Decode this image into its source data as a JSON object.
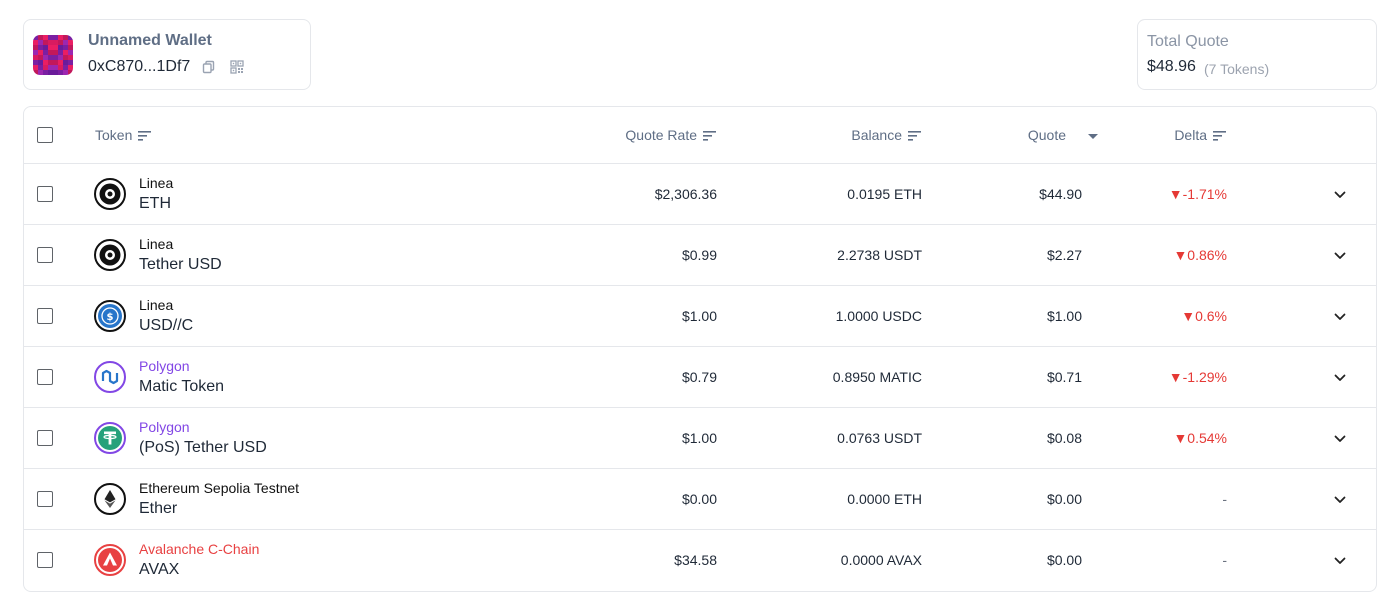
{
  "wallet": {
    "name": "Unnamed Wallet",
    "address": "0xC870...1Df7"
  },
  "total": {
    "label": "Total Quote",
    "value": "$48.96",
    "count": "(7 Tokens)"
  },
  "table": {
    "headers": {
      "token": "Token",
      "quote_rate": "Quote Rate",
      "balance": "Balance",
      "quote": "Quote",
      "delta": "Delta"
    },
    "rows": [
      {
        "chain": "Linea",
        "chain_color": "#111111",
        "token": "ETH",
        "rate": "$2,306.36",
        "balance": "0.0195 ETH",
        "quote": "$44.90",
        "delta": "▼-1.71%",
        "icon": "linea-icon"
      },
      {
        "chain": "Linea",
        "chain_color": "#111111",
        "token": "Tether USD",
        "rate": "$0.99",
        "balance": "2.2738 USDT",
        "quote": "$2.27",
        "delta": "▼0.86%",
        "icon": "linea-icon"
      },
      {
        "chain": "Linea",
        "chain_color": "#111111",
        "token": "USD//C",
        "rate": "$1.00",
        "balance": "1.0000 USDC",
        "quote": "$1.00",
        "delta": "▼0.6%",
        "icon": "usdc-icon"
      },
      {
        "chain": "Polygon",
        "chain_color": "#8247e5",
        "token": "Matic Token",
        "rate": "$0.79",
        "balance": "0.8950 MATIC",
        "quote": "$0.71",
        "delta": "▼-1.29%",
        "icon": "polygon-icon"
      },
      {
        "chain": "Polygon",
        "chain_color": "#8247e5",
        "token": "(PoS) Tether USD",
        "rate": "$1.00",
        "balance": "0.0763 USDT",
        "quote": "$0.08",
        "delta": "▼0.54%",
        "icon": "tether-icon"
      },
      {
        "chain": "Ethereum Sepolia Testnet",
        "chain_color": "#111111",
        "token": "Ether",
        "rate": "$0.00",
        "balance": "0.0000 ETH",
        "quote": "$0.00",
        "delta": "-",
        "icon": "ethereum-icon"
      },
      {
        "chain": "Avalanche C-Chain",
        "chain_color": "#e84142",
        "token": "AVAX",
        "rate": "$34.58",
        "balance": "0.0000 AVAX",
        "quote": "$0.00",
        "delta": "-",
        "icon": "avalanche-icon"
      }
    ]
  },
  "colors": {
    "negative": "#e53935",
    "polygon": "#8247e5",
    "avalanche": "#e84142",
    "header_text": "#5f6e85"
  }
}
